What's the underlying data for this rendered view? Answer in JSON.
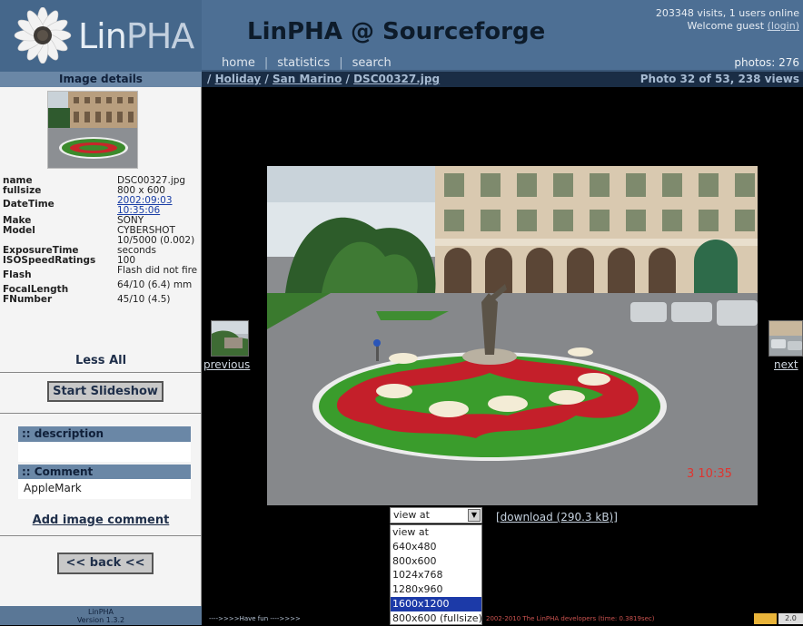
{
  "header": {
    "logo_text": "LinPHA",
    "site_title": "LinPHA @ Sourceforge",
    "visits": "203348 visits, 1 users online",
    "welcome": "Welcome guest",
    "login": "(login)",
    "photos": "photos: 276",
    "nav": [
      "home",
      "statistics",
      "search"
    ]
  },
  "sidebar": {
    "title": "Image details",
    "details": [
      {
        "key": "name",
        "value": "DSC00327.jpg"
      },
      {
        "key": "fullsize",
        "value": "800 x 600"
      },
      {
        "key": "DateTime",
        "value": "2002:09:03 10:35:06"
      },
      {
        "key": "Make",
        "value": "SONY"
      },
      {
        "key": "Model",
        "value": "CYBERSHOT"
      },
      {
        "key": "ExposureTime",
        "value": "10/5000 (0.002) seconds"
      },
      {
        "key": "ISOSpeedRatings",
        "value": "100"
      },
      {
        "key": "Flash",
        "value": "Flash did not fire"
      },
      {
        "key": "FocalLength",
        "value": "64/10 (6.4) mm"
      },
      {
        "key": "FNumber",
        "value": "45/10 (4.5)"
      }
    ],
    "less": "Less",
    "all": "All",
    "slideshow": "Start Slideshow",
    "description_label": ":: description",
    "description_value": "",
    "comment_label": ":: Comment",
    "comment_value": "AppleMark",
    "add_comment": "Add image comment",
    "back": "<< back <<"
  },
  "breadcrumb": {
    "sep": "/",
    "items": [
      "Holiday",
      "San Marino",
      "DSC00327.jpg"
    ],
    "photo_info": "Photo 32 of 53,  238 views"
  },
  "main": {
    "previous": "previous",
    "next": "next",
    "photo_stamp": "3 10:35",
    "select": {
      "value": "view at",
      "options": [
        "view at",
        "640x480",
        "800x600",
        "1024x768",
        "1280x960",
        "1600x1200",
        "800x600 (fullsize)"
      ],
      "selected_index": 5
    },
    "download": "[download (290.3 kB)]"
  },
  "footer": {
    "left_line1": "LinPHA",
    "left_line2": "Version 1.3.2",
    "mid": "---->>>>Have fun ---->>>>",
    "copyright": "2002-2010 The LinPHA developers (time: 0.3819sec)",
    "badge": "2.0"
  },
  "colors": {
    "header_bg": "#4d6f94",
    "sidebar_head_bg": "#6a87a6",
    "selected_option": "#1c3aa8"
  }
}
